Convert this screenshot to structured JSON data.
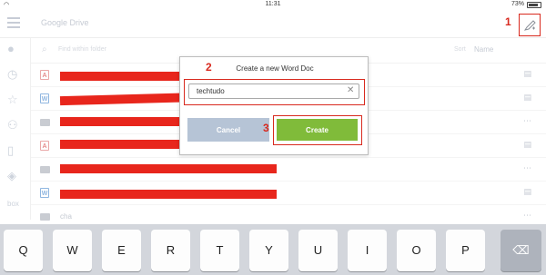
{
  "status": {
    "time": "11:31",
    "battery": "73%",
    "wifi_icon": "wifi-icon"
  },
  "header": {
    "title": "Google Drive",
    "new_doc_icon": "new-doc-icon"
  },
  "annotations": {
    "step1": "1",
    "step2": "2",
    "step3": "3"
  },
  "search": {
    "placeholder": "Find within folder",
    "sort_label": "Sort",
    "sort_value": "Name"
  },
  "sidebar": [
    "user-icon",
    "clock-icon",
    "star-icon",
    "shared-icon",
    "device-icon",
    "dropbox-icon",
    "box-icon"
  ],
  "files": [
    {
      "type": "pdf",
      "name": ""
    },
    {
      "type": "word",
      "name": ""
    },
    {
      "type": "folder",
      "name": ""
    },
    {
      "type": "pdf",
      "name": ""
    },
    {
      "type": "folder",
      "name": ""
    },
    {
      "type": "word",
      "name": ""
    },
    {
      "type": "folder",
      "name": "cha"
    }
  ],
  "dialog": {
    "title": "Create a new Word Doc",
    "input_value": "techtudo",
    "cancel_label": "Cancel",
    "create_label": "Create"
  },
  "keyboard": {
    "keys": [
      "Q",
      "W",
      "E",
      "R",
      "T",
      "Y",
      "U",
      "I",
      "O",
      "P"
    ]
  },
  "colors": {
    "annotation": "#d8291e",
    "create": "#80bb3a",
    "cancel": "#b6c4d6",
    "redaction": "#e8261c"
  }
}
